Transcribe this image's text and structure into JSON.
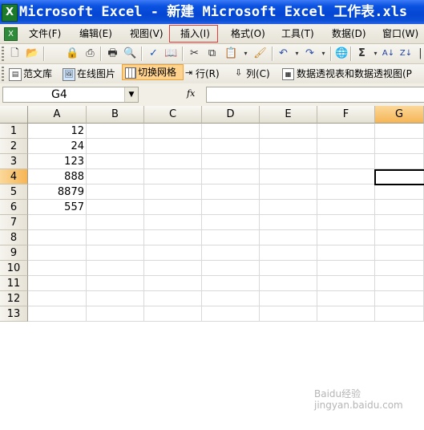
{
  "window": {
    "title": "Microsoft Excel - 新建 Microsoft Excel 工作表.xls",
    "app_icon": "excel-icon"
  },
  "menu": {
    "items": [
      "文件(F)",
      "编辑(E)",
      "视图(V)",
      "插入(I)",
      "格式(O)",
      "工具(T)",
      "数据(D)",
      "窗口(W)"
    ],
    "highlighted": "插入(I)"
  },
  "standard_toolbar": {
    "icons": [
      "new-icon",
      "open-icon",
      "permission-icon",
      "print-icon",
      "print-preview-icon",
      "spelling-icon",
      "research-icon",
      "cut-icon",
      "copy-icon",
      "paste-icon",
      "format-painter-icon",
      "undo-icon",
      "redo-icon",
      "hyperlink-icon",
      "autosum-icon",
      "sort-ascending-icon",
      "sort-descending-icon"
    ]
  },
  "custom_toolbar": {
    "items": [
      "范文库",
      "在线图片",
      "切换网格",
      "行(R)",
      "列(C)",
      "数据透视表和数据透视图(P"
    ],
    "active": "切换网格"
  },
  "formula_bar": {
    "name_box": "G4",
    "fx_label": "fx",
    "formula": ""
  },
  "sheet": {
    "columns": [
      "A",
      "B",
      "C",
      "D",
      "E",
      "F",
      "G"
    ],
    "selected_column": "G",
    "rows": [
      "1",
      "2",
      "3",
      "4",
      "5",
      "6",
      "7",
      "8",
      "9",
      "10",
      "11",
      "12",
      "13"
    ],
    "selected_row": "4",
    "column_a_values": [
      "12",
      "24",
      "123",
      "888",
      "8879",
      "557"
    ]
  },
  "watermark": {
    "line1": "Baidu经验",
    "line2": "jingyan.baidu.com"
  }
}
